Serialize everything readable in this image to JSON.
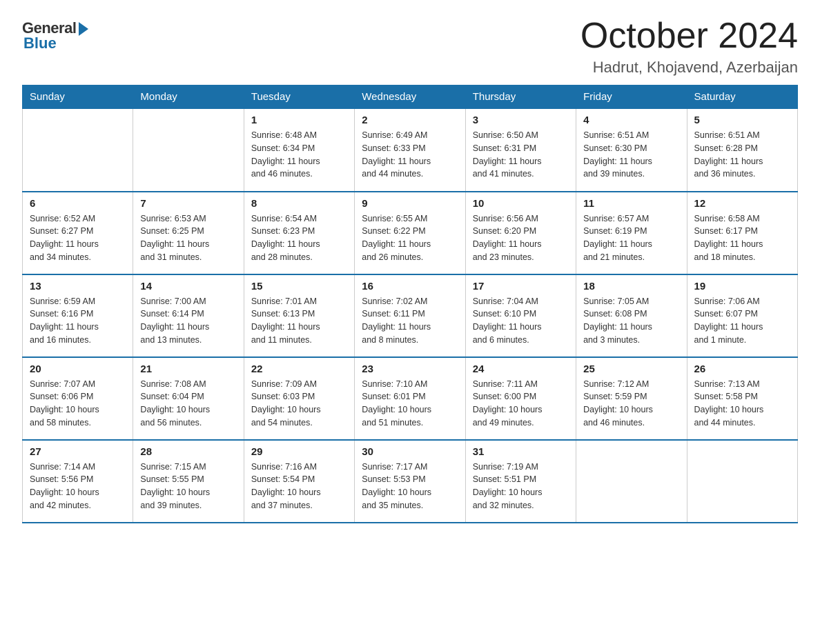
{
  "logo": {
    "general": "General",
    "blue": "Blue"
  },
  "title": "October 2024",
  "location": "Hadrut, Khojavend, Azerbaijan",
  "days_of_week": [
    "Sunday",
    "Monday",
    "Tuesday",
    "Wednesday",
    "Thursday",
    "Friday",
    "Saturday"
  ],
  "weeks": [
    [
      {
        "num": "",
        "info": ""
      },
      {
        "num": "",
        "info": ""
      },
      {
        "num": "1",
        "info": "Sunrise: 6:48 AM\nSunset: 6:34 PM\nDaylight: 11 hours\nand 46 minutes."
      },
      {
        "num": "2",
        "info": "Sunrise: 6:49 AM\nSunset: 6:33 PM\nDaylight: 11 hours\nand 44 minutes."
      },
      {
        "num": "3",
        "info": "Sunrise: 6:50 AM\nSunset: 6:31 PM\nDaylight: 11 hours\nand 41 minutes."
      },
      {
        "num": "4",
        "info": "Sunrise: 6:51 AM\nSunset: 6:30 PM\nDaylight: 11 hours\nand 39 minutes."
      },
      {
        "num": "5",
        "info": "Sunrise: 6:51 AM\nSunset: 6:28 PM\nDaylight: 11 hours\nand 36 minutes."
      }
    ],
    [
      {
        "num": "6",
        "info": "Sunrise: 6:52 AM\nSunset: 6:27 PM\nDaylight: 11 hours\nand 34 minutes."
      },
      {
        "num": "7",
        "info": "Sunrise: 6:53 AM\nSunset: 6:25 PM\nDaylight: 11 hours\nand 31 minutes."
      },
      {
        "num": "8",
        "info": "Sunrise: 6:54 AM\nSunset: 6:23 PM\nDaylight: 11 hours\nand 28 minutes."
      },
      {
        "num": "9",
        "info": "Sunrise: 6:55 AM\nSunset: 6:22 PM\nDaylight: 11 hours\nand 26 minutes."
      },
      {
        "num": "10",
        "info": "Sunrise: 6:56 AM\nSunset: 6:20 PM\nDaylight: 11 hours\nand 23 minutes."
      },
      {
        "num": "11",
        "info": "Sunrise: 6:57 AM\nSunset: 6:19 PM\nDaylight: 11 hours\nand 21 minutes."
      },
      {
        "num": "12",
        "info": "Sunrise: 6:58 AM\nSunset: 6:17 PM\nDaylight: 11 hours\nand 18 minutes."
      }
    ],
    [
      {
        "num": "13",
        "info": "Sunrise: 6:59 AM\nSunset: 6:16 PM\nDaylight: 11 hours\nand 16 minutes."
      },
      {
        "num": "14",
        "info": "Sunrise: 7:00 AM\nSunset: 6:14 PM\nDaylight: 11 hours\nand 13 minutes."
      },
      {
        "num": "15",
        "info": "Sunrise: 7:01 AM\nSunset: 6:13 PM\nDaylight: 11 hours\nand 11 minutes."
      },
      {
        "num": "16",
        "info": "Sunrise: 7:02 AM\nSunset: 6:11 PM\nDaylight: 11 hours\nand 8 minutes."
      },
      {
        "num": "17",
        "info": "Sunrise: 7:04 AM\nSunset: 6:10 PM\nDaylight: 11 hours\nand 6 minutes."
      },
      {
        "num": "18",
        "info": "Sunrise: 7:05 AM\nSunset: 6:08 PM\nDaylight: 11 hours\nand 3 minutes."
      },
      {
        "num": "19",
        "info": "Sunrise: 7:06 AM\nSunset: 6:07 PM\nDaylight: 11 hours\nand 1 minute."
      }
    ],
    [
      {
        "num": "20",
        "info": "Sunrise: 7:07 AM\nSunset: 6:06 PM\nDaylight: 10 hours\nand 58 minutes."
      },
      {
        "num": "21",
        "info": "Sunrise: 7:08 AM\nSunset: 6:04 PM\nDaylight: 10 hours\nand 56 minutes."
      },
      {
        "num": "22",
        "info": "Sunrise: 7:09 AM\nSunset: 6:03 PM\nDaylight: 10 hours\nand 54 minutes."
      },
      {
        "num": "23",
        "info": "Sunrise: 7:10 AM\nSunset: 6:01 PM\nDaylight: 10 hours\nand 51 minutes."
      },
      {
        "num": "24",
        "info": "Sunrise: 7:11 AM\nSunset: 6:00 PM\nDaylight: 10 hours\nand 49 minutes."
      },
      {
        "num": "25",
        "info": "Sunrise: 7:12 AM\nSunset: 5:59 PM\nDaylight: 10 hours\nand 46 minutes."
      },
      {
        "num": "26",
        "info": "Sunrise: 7:13 AM\nSunset: 5:58 PM\nDaylight: 10 hours\nand 44 minutes."
      }
    ],
    [
      {
        "num": "27",
        "info": "Sunrise: 7:14 AM\nSunset: 5:56 PM\nDaylight: 10 hours\nand 42 minutes."
      },
      {
        "num": "28",
        "info": "Sunrise: 7:15 AM\nSunset: 5:55 PM\nDaylight: 10 hours\nand 39 minutes."
      },
      {
        "num": "29",
        "info": "Sunrise: 7:16 AM\nSunset: 5:54 PM\nDaylight: 10 hours\nand 37 minutes."
      },
      {
        "num": "30",
        "info": "Sunrise: 7:17 AM\nSunset: 5:53 PM\nDaylight: 10 hours\nand 35 minutes."
      },
      {
        "num": "31",
        "info": "Sunrise: 7:19 AM\nSunset: 5:51 PM\nDaylight: 10 hours\nand 32 minutes."
      },
      {
        "num": "",
        "info": ""
      },
      {
        "num": "",
        "info": ""
      }
    ]
  ]
}
